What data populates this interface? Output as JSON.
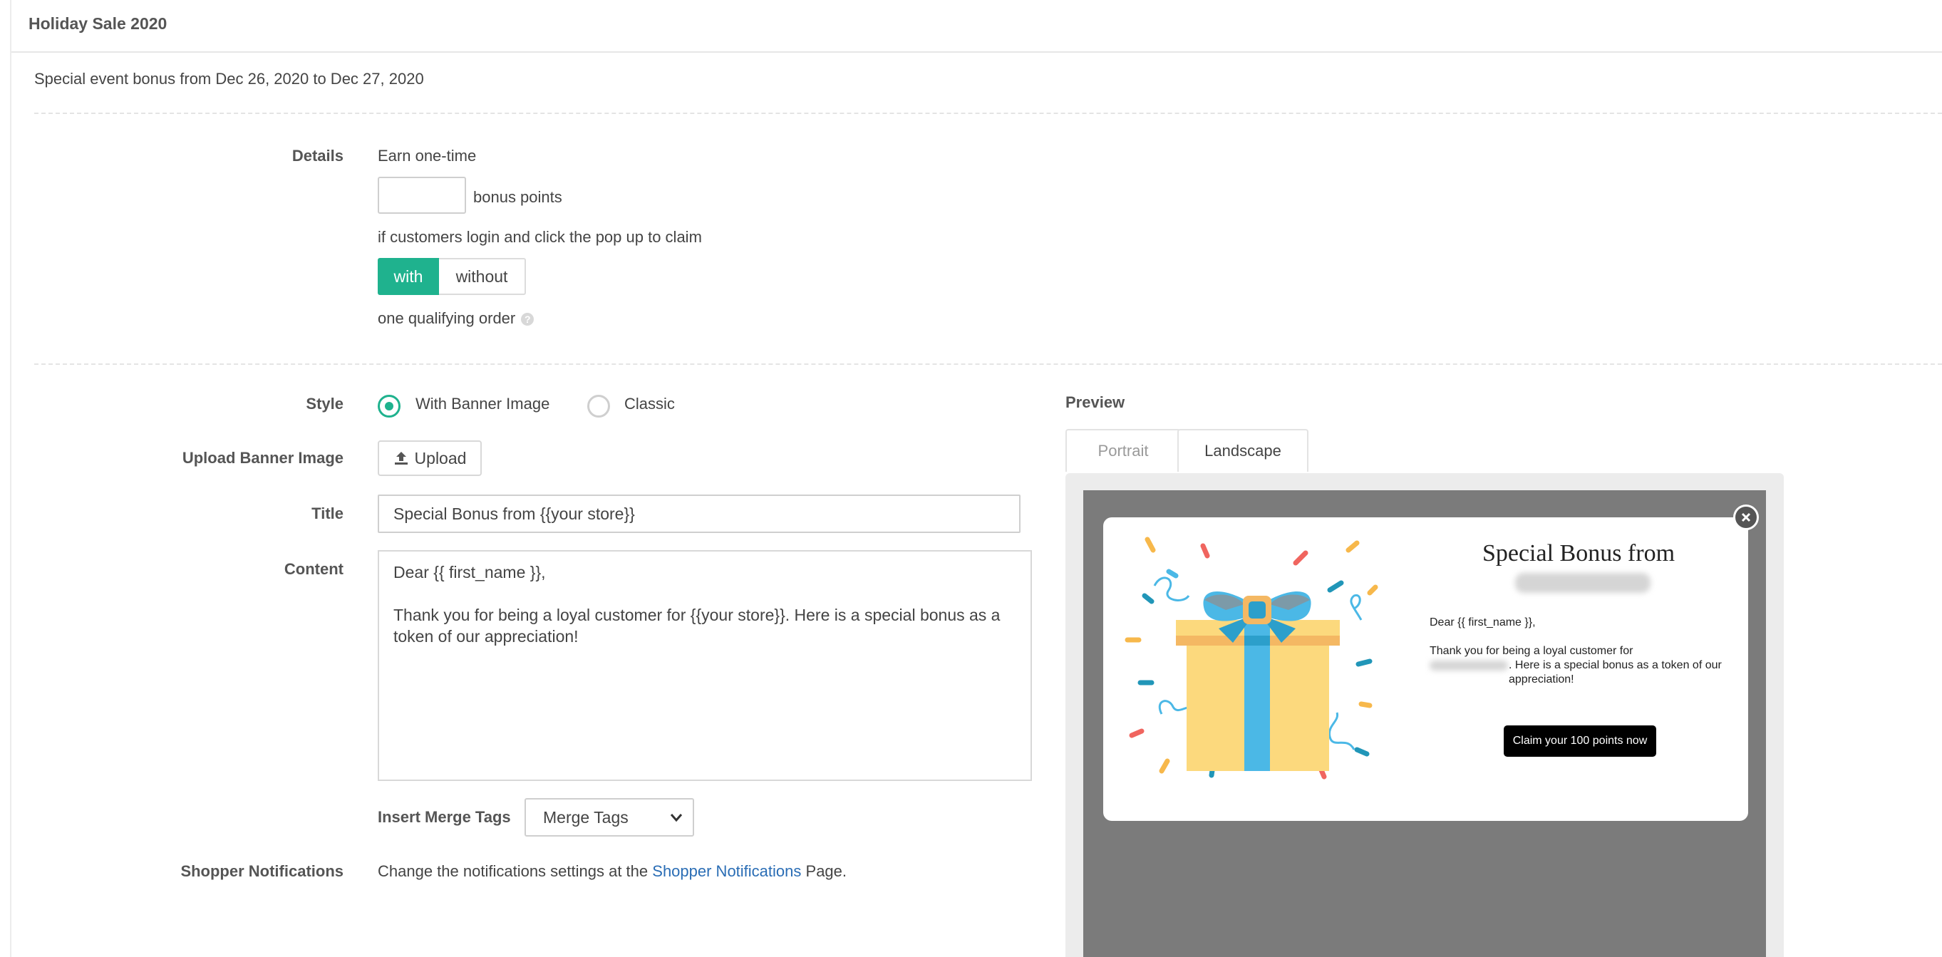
{
  "header": {
    "title": "Holiday Sale 2020"
  },
  "subtitle": "Special event bonus from Dec 26, 2020 to Dec 27, 2020",
  "details": {
    "label": "Details",
    "earn_text": "Earn one-time",
    "points_value": "",
    "points_suffix": "bonus points",
    "claim_text": "if customers login and click the pop up to claim",
    "toggle_with": "with",
    "toggle_without": "without",
    "selected": "with",
    "order_text": "one qualifying order",
    "help_glyph": "?"
  },
  "style": {
    "label": "Style",
    "options": [
      "With Banner Image",
      "Classic"
    ],
    "selected": "With Banner Image"
  },
  "upload": {
    "label": "Upload Banner Image",
    "button": "Upload"
  },
  "title_field": {
    "label": "Title",
    "value": "Special Bonus from {{your store}}"
  },
  "content_field": {
    "label": "Content",
    "line1": "Dear {{ first_name }},",
    "line2": "Thank you for being a loyal customer for {{your store}}. Here is a special bonus as a token of our appreciation!"
  },
  "merge": {
    "label": "Insert Merge Tags",
    "selected": "Merge Tags"
  },
  "notifications": {
    "label": "Shopper Notifications",
    "text_before": "Change the notifications settings at the",
    "link": "Shopper Notifications",
    "text_after": "Page."
  },
  "preview": {
    "label": "Preview",
    "tabs": [
      "Portrait",
      "Landscape"
    ],
    "active_tab": "Landscape",
    "modal": {
      "title": "Special Bonus from",
      "greeting": "Dear {{ first_name }},",
      "body_start": "Thank you for being a loyal customer for",
      "body_end": ". Here is a special bonus as a token of our appreciation!",
      "button": "Claim your 100 points now"
    }
  },
  "colors": {
    "accent": "#1fb28e",
    "link": "#2a6db5",
    "preview_backdrop": "#7b7b7b",
    "gift_box": "#fcd97d",
    "gift_ribbon": "#4bb8e6"
  }
}
